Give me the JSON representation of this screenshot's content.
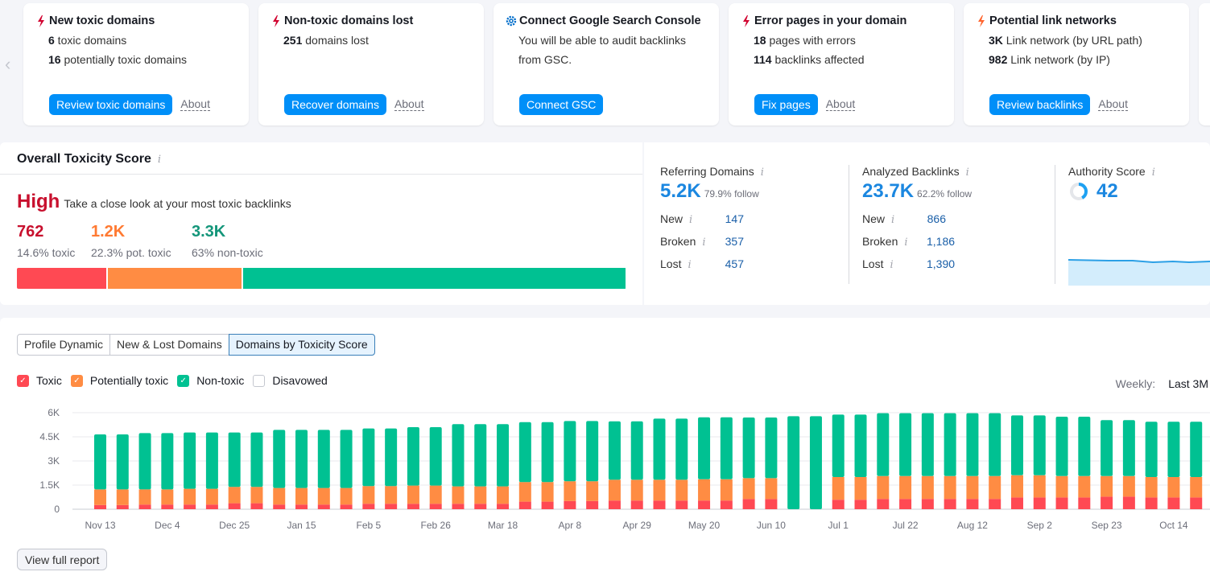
{
  "carousel": {
    "cards": [
      {
        "title": "New toxic domains",
        "icon": "lightning-icon",
        "icon_color": "#d1002f",
        "lines": [
          {
            "num": "6",
            "text": " toxic domains"
          },
          {
            "num": "16",
            "text": " potentially toxic domains"
          }
        ],
        "button": "Review toxic domains",
        "about": "About"
      },
      {
        "title": "Non-toxic domains lost",
        "icon": "lightning-icon",
        "icon_color": "#d1002f",
        "lines": [
          {
            "num": "251",
            "text": " domains lost"
          }
        ],
        "button": "Recover domains",
        "about": "About"
      },
      {
        "title": "Connect Google Search Console",
        "icon": "gear-icon",
        "icon_color": "#006dca",
        "lines": [
          {
            "num": "",
            "text": "You will be able to audit backlinks"
          },
          {
            "num": "",
            "text": "from GSC."
          }
        ],
        "button": "Connect GSC",
        "about": ""
      },
      {
        "title": "Error pages in your domain",
        "icon": "lightning-icon",
        "icon_color": "#d1002f",
        "lines": [
          {
            "num": "18",
            "text": " pages with errors"
          },
          {
            "num": "114",
            "text": " backlinks affected"
          }
        ],
        "button": "Fix pages",
        "about": "About"
      },
      {
        "title": "Potential link networks",
        "icon": "lightning-icon",
        "icon_color": "#ff642d",
        "lines": [
          {
            "num": "3K",
            "text": " Link network (by URL path)"
          },
          {
            "num": "982",
            "text": " Link network (by IP)"
          }
        ],
        "button": "Review backlinks",
        "about": "About"
      }
    ]
  },
  "toxicity": {
    "title": "Overall Toxicity Score",
    "level": "High",
    "level_desc": "Take a close look at your most toxic backlinks",
    "stats": [
      {
        "value": "762",
        "label": "14.6% toxic",
        "color": "#c8102e"
      },
      {
        "value": "1.2K",
        "label": "22.3% pot. toxic",
        "color": "#ff8c43"
      },
      {
        "value": "3.3K",
        "label": "63% non-toxic",
        "color": "#1a9e77"
      }
    ],
    "bar": [
      {
        "name": "toxic",
        "share": 14.6,
        "color": "#ff4953"
      },
      {
        "name": "potentially-toxic",
        "share": 22.3,
        "color": "#ff8c43"
      },
      {
        "name": "non-toxic",
        "share": 63,
        "color": "#00c192"
      }
    ]
  },
  "metrics": {
    "referring": {
      "title": "Referring Domains",
      "value": "5.2K",
      "follow": "79.9% follow",
      "rows": [
        {
          "k": "New",
          "v": "147"
        },
        {
          "k": "Broken",
          "v": "357"
        },
        {
          "k": "Lost",
          "v": "457"
        }
      ]
    },
    "backlinks": {
      "title": "Analyzed Backlinks",
      "value": "23.7K",
      "follow": "62.2% follow",
      "rows": [
        {
          "k": "New",
          "v": "866"
        },
        {
          "k": "Broken",
          "v": "1,186"
        },
        {
          "k": "Lost",
          "v": "1,390"
        }
      ]
    },
    "authority": {
      "title": "Authority Score",
      "value": "42",
      "score_fraction": 0.42
    }
  },
  "tabs": [
    {
      "label": "Profile Dynamic",
      "active": false
    },
    {
      "label": "New & Lost Domains",
      "active": false
    },
    {
      "label": "Domains by Toxicity Score",
      "active": true
    }
  ],
  "legend": [
    {
      "label": "Toxic",
      "color": "#ff4953",
      "checked": true
    },
    {
      "label": "Potentially toxic",
      "color": "#ff8c43",
      "checked": true
    },
    {
      "label": "Non-toxic",
      "color": "#00c192",
      "checked": true
    },
    {
      "label": "Disavowed",
      "color": "#ffffff",
      "checked": false
    }
  ],
  "period": {
    "label": "Weekly:",
    "value": "Last 3M"
  },
  "view_full_report": "View full report",
  "chart_data": {
    "type": "bar",
    "stacked": true,
    "title": "Domains by Toxicity Score",
    "xlabel": "",
    "ylabel": "",
    "ylim": [
      0,
      6000
    ],
    "yticks": [
      "0",
      "1.5K",
      "3K",
      "4.5K",
      "6K"
    ],
    "ytick_values": [
      0,
      1500,
      3000,
      4500,
      6000
    ],
    "xtick_labels": [
      "Nov 13",
      "Dec 4",
      "Dec 25",
      "Jan 15",
      "Feb 5",
      "Feb 26",
      "Mar 18",
      "Apr 8",
      "Apr 29",
      "May 20",
      "Jun 10",
      "Jul 1",
      "Jul 22",
      "Aug 12",
      "Sep 2",
      "Sep 23",
      "Oct 14"
    ],
    "xtick_every": 3,
    "grid": true,
    "series": [
      {
        "name": "Toxic",
        "color": "#ff4953",
        "values": [
          260,
          260,
          290,
          290,
          290,
          290,
          370,
          370,
          290,
          290,
          290,
          290,
          340,
          340,
          340,
          340,
          340,
          340,
          340,
          470,
          470,
          510,
          510,
          540,
          540,
          540,
          540,
          540,
          540,
          630,
          630,
          0,
          0,
          590,
          590,
          640,
          640,
          640,
          640,
          640,
          640,
          730,
          730,
          730,
          730,
          780,
          780,
          730,
          730,
          730
        ]
      },
      {
        "name": "Potentially toxic",
        "color": "#ff8c43",
        "values": [
          970,
          970,
          940,
          940,
          980,
          980,
          1020,
          1020,
          1030,
          1030,
          1030,
          1030,
          1100,
          1100,
          1130,
          1130,
          1080,
          1080,
          1080,
          1220,
          1220,
          1230,
          1230,
          1290,
          1290,
          1290,
          1290,
          1320,
          1320,
          1300,
          1300,
          0,
          0,
          1410,
          1410,
          1420,
          1420,
          1420,
          1420,
          1420,
          1420,
          1380,
          1380,
          1330,
          1330,
          1280,
          1280,
          1270,
          1270,
          1270
        ]
      },
      {
        "name": "Non-toxic",
        "color": "#00c192",
        "values": [
          3420,
          3420,
          3500,
          3500,
          3500,
          3500,
          3380,
          3380,
          3610,
          3610,
          3610,
          3610,
          3580,
          3580,
          3630,
          3630,
          3870,
          3870,
          3870,
          3720,
          3720,
          3740,
          3740,
          3630,
          3630,
          3800,
          3800,
          3850,
          3850,
          3770,
          3770,
          5780,
          5780,
          3880,
          3880,
          3910,
          3910,
          3910,
          3910,
          3910,
          3910,
          3720,
          3720,
          3690,
          3690,
          3480,
          3480,
          3440,
          3440,
          3440
        ]
      }
    ]
  }
}
